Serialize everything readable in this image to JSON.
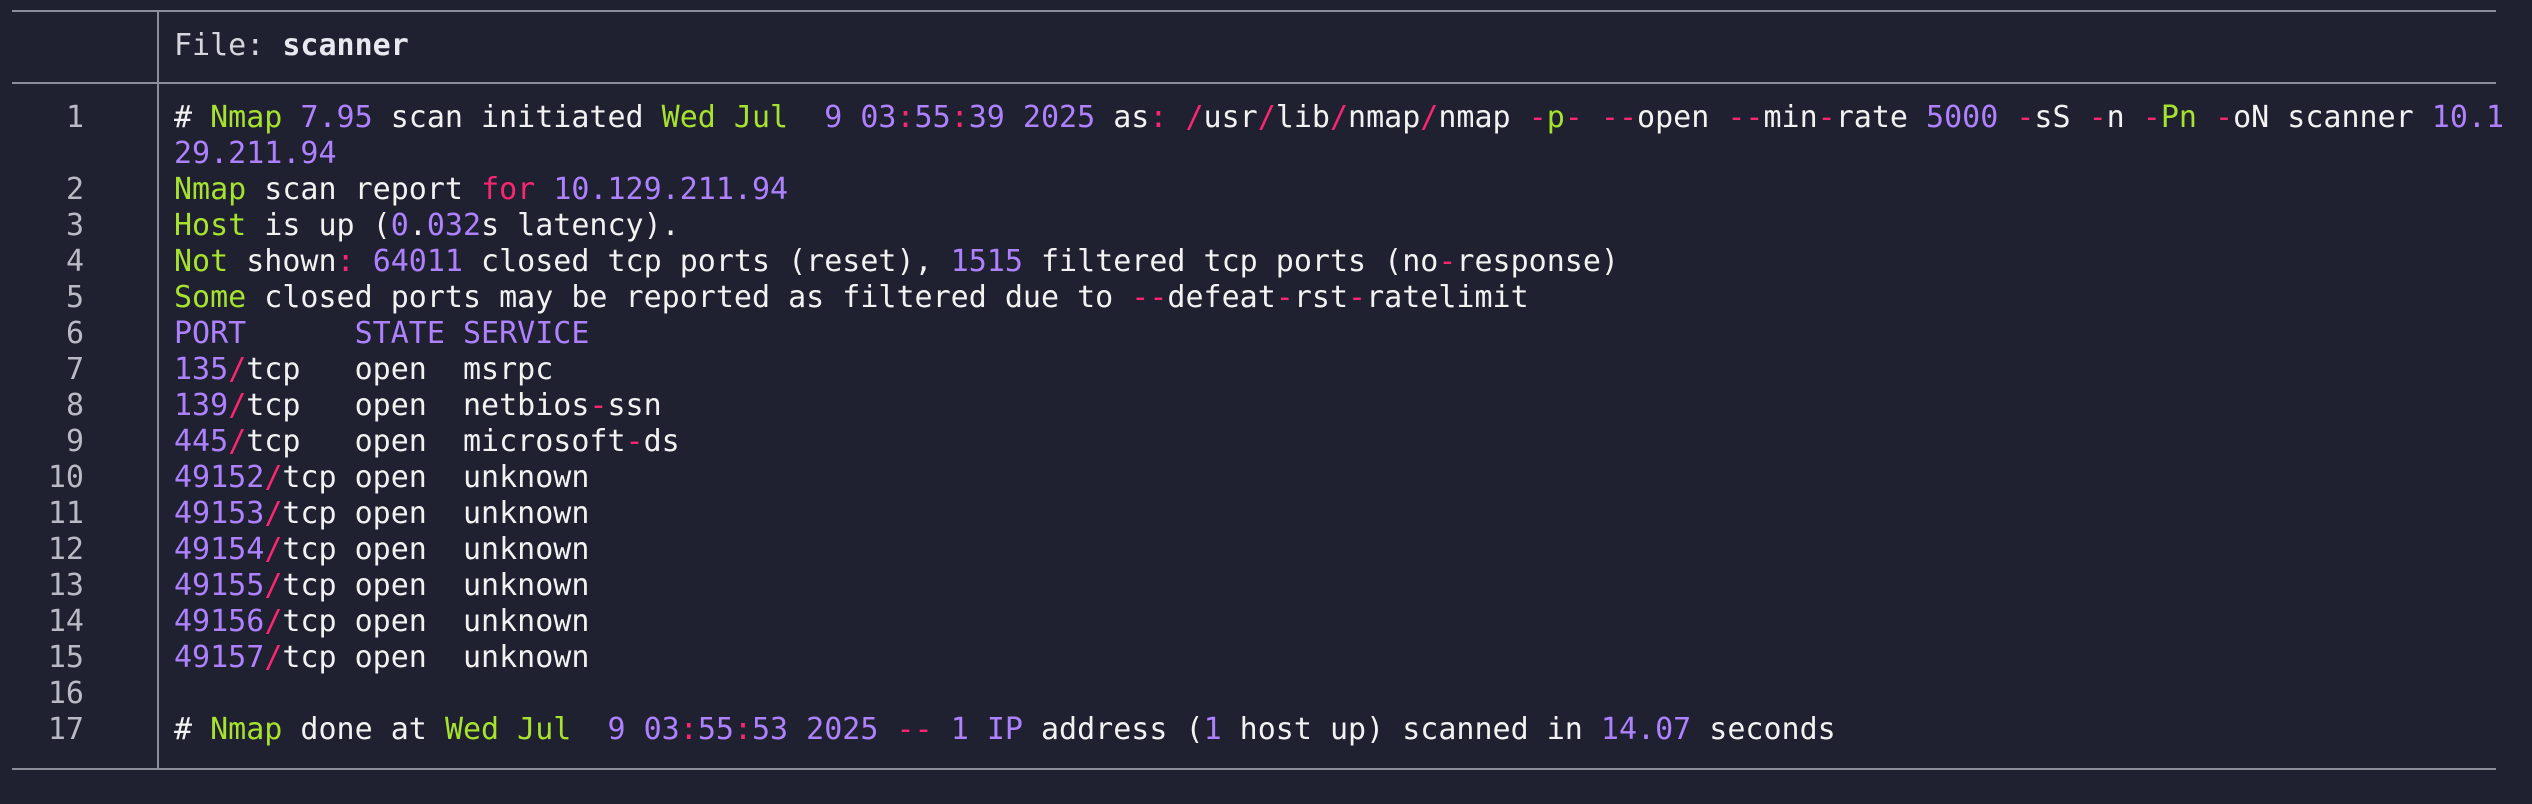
{
  "file_label": "File:",
  "file_name": "scanner",
  "lines": [
    {
      "n": "1",
      "segs": [
        [
          "w",
          "# "
        ],
        [
          "g",
          "Nmap"
        ],
        [
          "w",
          " "
        ],
        [
          "p",
          "7.95"
        ],
        [
          "w",
          " scan initiated "
        ],
        [
          "g",
          "Wed Jul  "
        ],
        [
          "p",
          "9 03"
        ],
        [
          "r",
          ":"
        ],
        [
          "p",
          "55"
        ],
        [
          "r",
          ":"
        ],
        [
          "p",
          "39 2025"
        ],
        [
          "w",
          " as"
        ],
        [
          "r",
          ":"
        ],
        [
          "w",
          " "
        ],
        [
          "r",
          "/"
        ],
        [
          "w",
          "usr"
        ],
        [
          "r",
          "/"
        ],
        [
          "w",
          "lib"
        ],
        [
          "r",
          "/"
        ],
        [
          "w",
          "nmap"
        ],
        [
          "r",
          "/"
        ],
        [
          "w",
          "nmap "
        ],
        [
          "r",
          "-"
        ],
        [
          "g",
          "p"
        ],
        [
          "r",
          "-"
        ],
        [
          "w",
          " "
        ],
        [
          "r",
          "--"
        ],
        [
          "w",
          "open "
        ],
        [
          "r",
          "--"
        ],
        [
          "w",
          "min"
        ],
        [
          "r",
          "-"
        ],
        [
          "w",
          "rate "
        ],
        [
          "p",
          "5000"
        ],
        [
          "w",
          " "
        ],
        [
          "r",
          "-"
        ],
        [
          "w",
          "sS "
        ],
        [
          "r",
          "-"
        ],
        [
          "w",
          "n "
        ],
        [
          "r",
          "-"
        ],
        [
          "g",
          "Pn"
        ],
        [
          "w",
          " "
        ],
        [
          "r",
          "-"
        ],
        [
          "w",
          "oN scanner "
        ],
        [
          "p",
          "10.1"
        ]
      ]
    },
    {
      "n": "",
      "segs": [
        [
          "p",
          "29.211.94"
        ]
      ]
    },
    {
      "n": "2",
      "segs": [
        [
          "g",
          "Nmap"
        ],
        [
          "w",
          " scan report "
        ],
        [
          "r",
          "for"
        ],
        [
          "w",
          " "
        ],
        [
          "p",
          "10.129.211.94"
        ]
      ]
    },
    {
      "n": "3",
      "segs": [
        [
          "g",
          "Host"
        ],
        [
          "w",
          " is up ("
        ],
        [
          "p",
          "0"
        ],
        [
          "w",
          "."
        ],
        [
          "p",
          "032"
        ],
        [
          "w",
          "s latency)."
        ]
      ]
    },
    {
      "n": "4",
      "segs": [
        [
          "g",
          "Not"
        ],
        [
          "w",
          " shown"
        ],
        [
          "r",
          ":"
        ],
        [
          "w",
          " "
        ],
        [
          "p",
          "64011"
        ],
        [
          "w",
          " closed tcp ports (reset), "
        ],
        [
          "p",
          "1515"
        ],
        [
          "w",
          " filtered tcp ports (no"
        ],
        [
          "r",
          "-"
        ],
        [
          "w",
          "response)"
        ]
      ]
    },
    {
      "n": "5",
      "segs": [
        [
          "g",
          "Some"
        ],
        [
          "w",
          " closed ports may be reported as filtered due to "
        ],
        [
          "r",
          "--"
        ],
        [
          "w",
          "defeat"
        ],
        [
          "r",
          "-"
        ],
        [
          "w",
          "rst"
        ],
        [
          "r",
          "-"
        ],
        [
          "w",
          "ratelimit"
        ]
      ]
    },
    {
      "n": "6",
      "segs": [
        [
          "p",
          "PORT      STATE SERVICE"
        ]
      ]
    },
    {
      "n": "7",
      "segs": [
        [
          "p",
          "135"
        ],
        [
          "r",
          "/"
        ],
        [
          "w",
          "tcp   open  msrpc"
        ]
      ]
    },
    {
      "n": "8",
      "segs": [
        [
          "p",
          "139"
        ],
        [
          "r",
          "/"
        ],
        [
          "w",
          "tcp   open  netbios"
        ],
        [
          "r",
          "-"
        ],
        [
          "w",
          "ssn"
        ]
      ]
    },
    {
      "n": "9",
      "segs": [
        [
          "p",
          "445"
        ],
        [
          "r",
          "/"
        ],
        [
          "w",
          "tcp   open  microsoft"
        ],
        [
          "r",
          "-"
        ],
        [
          "w",
          "ds"
        ]
      ]
    },
    {
      "n": "10",
      "segs": [
        [
          "p",
          "49152"
        ],
        [
          "r",
          "/"
        ],
        [
          "w",
          "tcp open  unknown"
        ]
      ]
    },
    {
      "n": "11",
      "segs": [
        [
          "p",
          "49153"
        ],
        [
          "r",
          "/"
        ],
        [
          "w",
          "tcp open  unknown"
        ]
      ]
    },
    {
      "n": "12",
      "segs": [
        [
          "p",
          "49154"
        ],
        [
          "r",
          "/"
        ],
        [
          "w",
          "tcp open  unknown"
        ]
      ]
    },
    {
      "n": "13",
      "segs": [
        [
          "p",
          "49155"
        ],
        [
          "r",
          "/"
        ],
        [
          "w",
          "tcp open  unknown"
        ]
      ]
    },
    {
      "n": "14",
      "segs": [
        [
          "p",
          "49156"
        ],
        [
          "r",
          "/"
        ],
        [
          "w",
          "tcp open  unknown"
        ]
      ]
    },
    {
      "n": "15",
      "segs": [
        [
          "p",
          "49157"
        ],
        [
          "r",
          "/"
        ],
        [
          "w",
          "tcp open  unknown"
        ]
      ]
    },
    {
      "n": "16",
      "segs": []
    },
    {
      "n": "17",
      "segs": [
        [
          "w",
          "# "
        ],
        [
          "g",
          "Nmap"
        ],
        [
          "w",
          " done at "
        ],
        [
          "g",
          "Wed Jul  "
        ],
        [
          "p",
          "9 03"
        ],
        [
          "r",
          ":"
        ],
        [
          "p",
          "55"
        ],
        [
          "r",
          ":"
        ],
        [
          "p",
          "53 2025"
        ],
        [
          "w",
          " "
        ],
        [
          "r",
          "--"
        ],
        [
          "w",
          " "
        ],
        [
          "p",
          "1"
        ],
        [
          "w",
          " "
        ],
        [
          "p",
          "IP"
        ],
        [
          "w",
          " address ("
        ],
        [
          "p",
          "1"
        ],
        [
          "w",
          " host up) scanned in "
        ],
        [
          "p",
          "14.07"
        ],
        [
          "w",
          " seconds"
        ]
      ]
    }
  ],
  "colors": {
    "green": "#a6e22e",
    "purple": "#ae81ff",
    "red": "#f92672",
    "text": "#f2f2f2",
    "background": "#1f2030"
  }
}
